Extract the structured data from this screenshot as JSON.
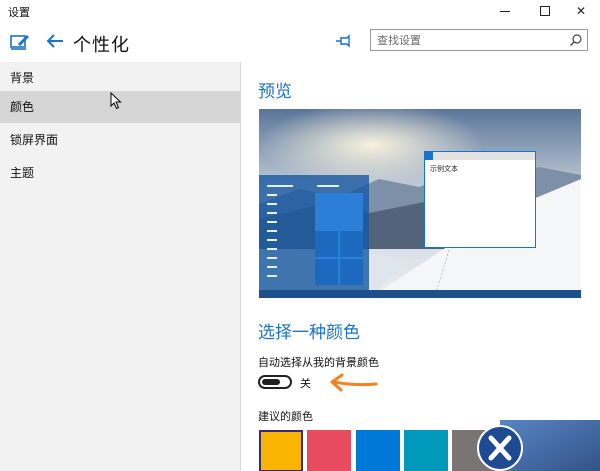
{
  "window": {
    "title": "设置"
  },
  "header": {
    "page_title": "个性化",
    "search_placeholder": "查找设置"
  },
  "sidebar": {
    "items": [
      {
        "label": "背景",
        "active": false
      },
      {
        "label": "颜色",
        "active": true
      },
      {
        "label": "锁屏界面",
        "active": false
      },
      {
        "label": "主题",
        "active": false
      }
    ]
  },
  "main": {
    "preview_heading": "预览",
    "sample_window_text": "示例文本",
    "color_heading": "选择一种颜色",
    "auto_color_label": "自动选择从我的背景颜色",
    "toggle_state": "关",
    "suggested_label": "建议的颜色",
    "swatches": [
      {
        "color": "#f8b400",
        "selected": true
      },
      {
        "color": "#e84a5f",
        "selected": false
      },
      {
        "color": "#0078d7",
        "selected": false
      },
      {
        "color": "#0099bc",
        "selected": false
      },
      {
        "color": "#7a7574",
        "selected": false
      }
    ]
  },
  "colors": {
    "accent": "#1a73c8",
    "sidebar_bg": "#f2f2f2",
    "sidebar_active": "#d6d6d6",
    "annotation_arrow": "#f58220"
  },
  "icons": {
    "app": "personalize-icon",
    "back": "back-arrow-icon",
    "pin": "pin-icon",
    "search": "search-icon"
  }
}
